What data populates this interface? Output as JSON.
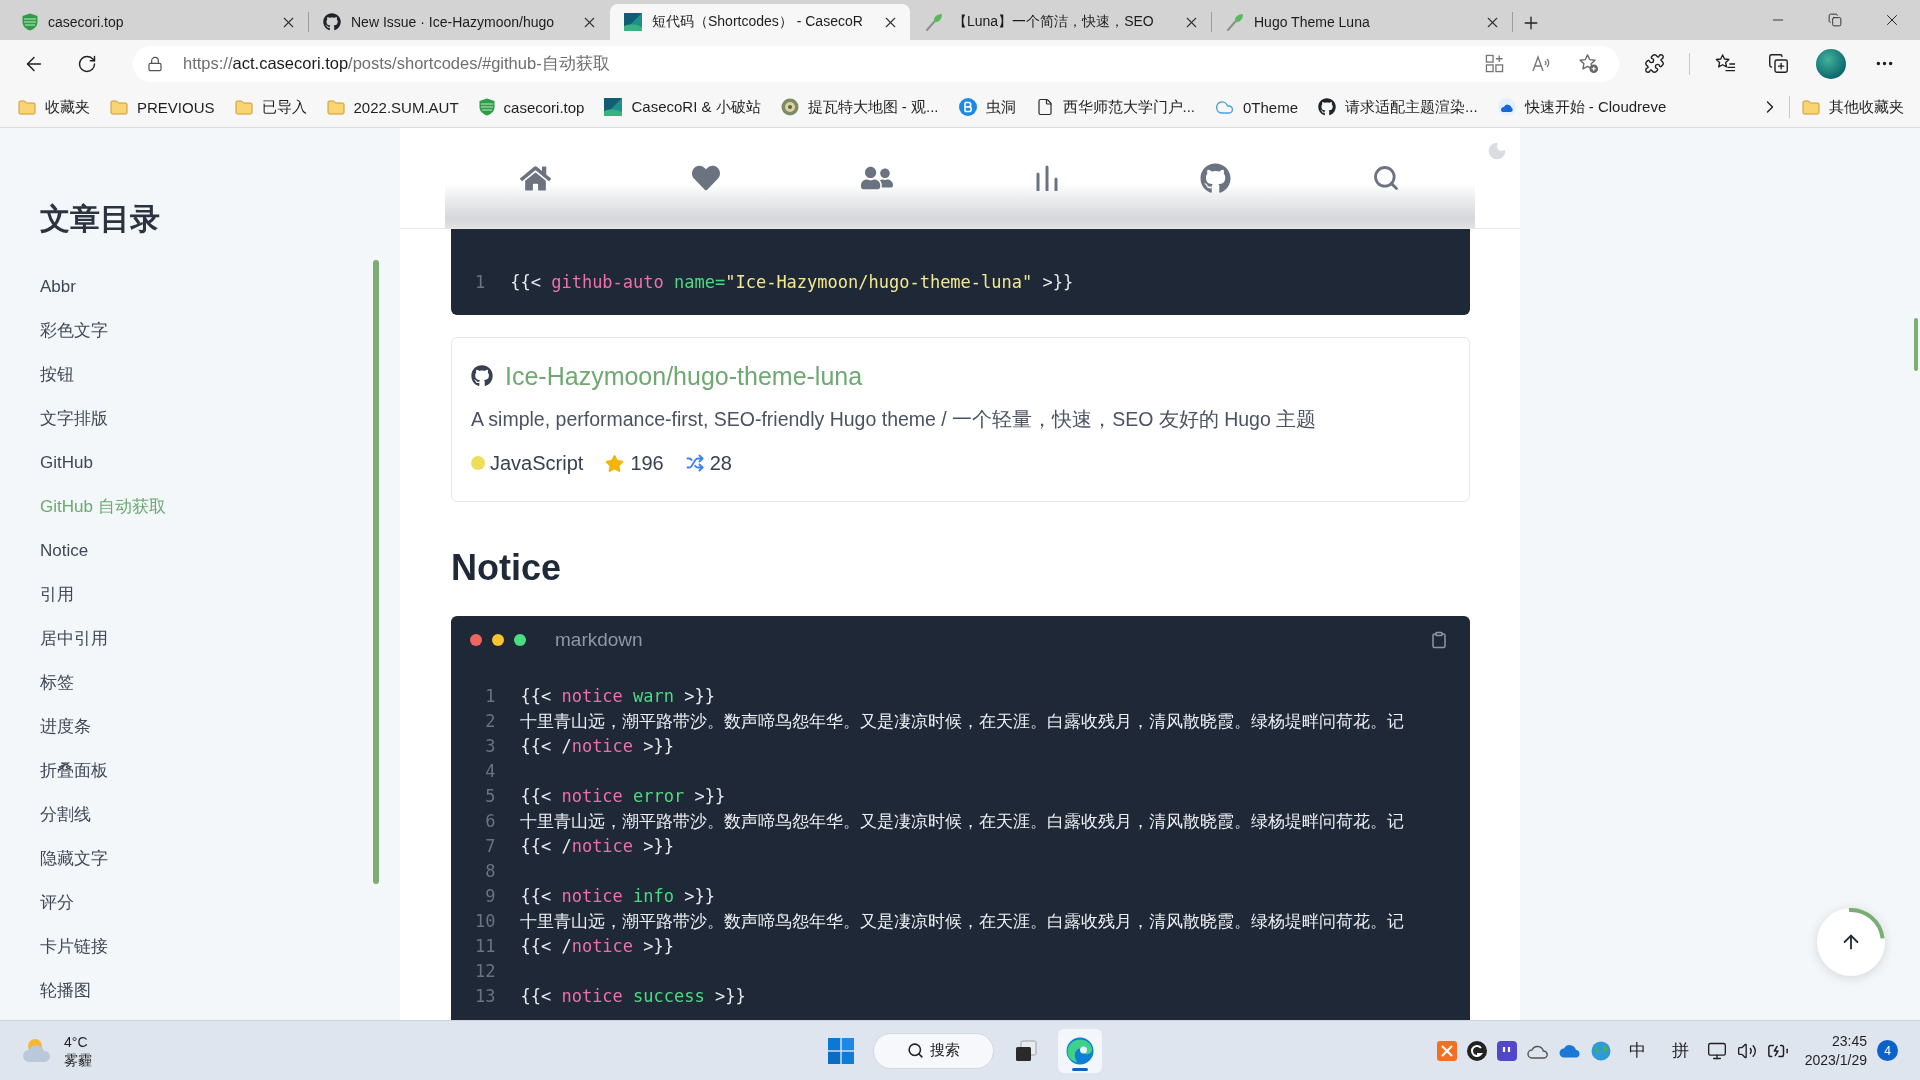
{
  "browser": {
    "tabs": [
      {
        "title": "casecori.top",
        "kind": "shield",
        "selected": false
      },
      {
        "title": "New Issue · Ice-Hazymoon/hugo",
        "kind": "github",
        "selected": false
      },
      {
        "title": "短代码（Shortcodes） - CasecoR",
        "kind": "tile",
        "selected": true
      },
      {
        "title": "【Luna】一个简洁，快速，SEO",
        "kind": "leaf",
        "selected": false
      },
      {
        "title": "Hugo Theme Luna",
        "kind": "leaf",
        "selected": false
      }
    ],
    "url": {
      "scheme": "https://",
      "host": "act.casecori.top",
      "path": "/posts/shortcodes/#github-自动获取"
    },
    "bookmarks": [
      {
        "label": "收藏夹",
        "kind": "folder"
      },
      {
        "label": "PREVIOUS",
        "kind": "folder"
      },
      {
        "label": "已导入",
        "kind": "folder"
      },
      {
        "label": "2022.SUM.AUT",
        "kind": "folder"
      },
      {
        "label": "casecori.top",
        "kind": "shield"
      },
      {
        "label": "CasecoRI & 小破站",
        "kind": "tile"
      },
      {
        "label": "提瓦特大地图 - 观...",
        "kind": "emblem"
      },
      {
        "label": "虫洞",
        "kind": "disc"
      },
      {
        "label": "西华师范大学门户...",
        "kind": "page"
      },
      {
        "label": "0Theme",
        "kind": "cloud"
      },
      {
        "label": "请求适配主题渲染...",
        "kind": "github"
      },
      {
        "label": "快速开始 - Cloudreve",
        "kind": "cloudlogo"
      }
    ],
    "other_bookmarks": {
      "label": "其他收藏夹",
      "kind": "folder"
    }
  },
  "toc": {
    "title": "文章目录",
    "items": [
      {
        "label": "Abbr",
        "selected": false
      },
      {
        "label": "彩色文字",
        "selected": false
      },
      {
        "label": "按钮",
        "selected": false
      },
      {
        "label": "文字排版",
        "selected": false
      },
      {
        "label": "GitHub",
        "selected": false
      },
      {
        "label": "GitHub 自动获取",
        "selected": true
      },
      {
        "label": "Notice",
        "selected": false
      },
      {
        "label": "引用",
        "selected": false
      },
      {
        "label": "居中引用",
        "selected": false
      },
      {
        "label": "标签",
        "selected": false
      },
      {
        "label": "进度条",
        "selected": false
      },
      {
        "label": "折叠面板",
        "selected": false
      },
      {
        "label": "分割线",
        "selected": false
      },
      {
        "label": "隐藏文字",
        "selected": false
      },
      {
        "label": "评分",
        "selected": false
      },
      {
        "label": "卡片链接",
        "selected": false
      },
      {
        "label": "轮播图",
        "selected": false
      }
    ]
  },
  "article": {
    "blocks": [
      {
        "kind": "code",
        "lines": [
          {
            "number": "1",
            "tokens": [
              {
                "text": "{{< ",
                "kind": "punct"
              },
              {
                "text": "github-auto",
                "kind": "name"
              },
              {
                "text": " name=",
                "kind": "param"
              },
              {
                "text": "\"Ice-Hazymoon/hugo-theme-luna\"",
                "kind": "string"
              },
              {
                "text": " >}}",
                "kind": "punct"
              }
            ]
          }
        ]
      },
      {
        "kind": "repo",
        "name": "Ice-Hazymoon/hugo-theme-luna",
        "description": "A simple, performance-first, SEO-friendly Hugo theme / 一个轻量，快速，SEO 友好的 Hugo 主题",
        "language": "JavaScript",
        "star_count": "196",
        "fork_count": "28"
      },
      {
        "kind": "heading",
        "text": "Notice"
      },
      {
        "kind": "code",
        "language": "markdown",
        "lines": [
          {
            "number": "1",
            "tokens": [
              {
                "text": "{{< ",
                "kind": "punct"
              },
              {
                "text": "notice",
                "kind": "name"
              },
              {
                "text": " warn",
                "kind": "param"
              },
              {
                "text": " >}}",
                "kind": "punct"
              }
            ]
          },
          {
            "number": "2",
            "tokens": [
              {
                "text": "十里青山远，潮平路带沙。数声啼鸟怨年华。又是凄凉时候，在天涯。白露收残月，清风散晓霞。绿杨堤畔问荷花。记",
                "kind": "text"
              }
            ]
          },
          {
            "number": "3",
            "tokens": [
              {
                "text": "{{< /",
                "kind": "punct"
              },
              {
                "text": "notice",
                "kind": "name"
              },
              {
                "text": " >}}",
                "kind": "punct"
              }
            ]
          },
          {
            "number": "4"
          },
          {
            "number": "5",
            "tokens": [
              {
                "text": "{{< ",
                "kind": "punct"
              },
              {
                "text": "notice",
                "kind": "name"
              },
              {
                "text": " error",
                "kind": "param"
              },
              {
                "text": " >}}",
                "kind": "punct"
              }
            ]
          },
          {
            "number": "6",
            "tokens": [
              {
                "text": "十里青山远，潮平路带沙。数声啼鸟怨年华。又是凄凉时候，在天涯。白露收残月，清风散晓霞。绿杨堤畔问荷花。记",
                "kind": "text"
              }
            ]
          },
          {
            "number": "7",
            "tokens": [
              {
                "text": "{{< /",
                "kind": "punct"
              },
              {
                "text": "notice",
                "kind": "name"
              },
              {
                "text": " >}}",
                "kind": "punct"
              }
            ]
          },
          {
            "number": "8"
          },
          {
            "number": "9",
            "tokens": [
              {
                "text": "{{< ",
                "kind": "punct"
              },
              {
                "text": "notice",
                "kind": "name"
              },
              {
                "text": " info",
                "kind": "param"
              },
              {
                "text": " >}}",
                "kind": "punct"
              }
            ]
          },
          {
            "number": "10",
            "tokens": [
              {
                "text": "十里青山远，潮平路带沙。数声啼鸟怨年华。又是凄凉时候，在天涯。白露收残月，清风散晓霞。绿杨堤畔问荷花。记",
                "kind": "text"
              }
            ]
          },
          {
            "number": "11",
            "tokens": [
              {
                "text": "{{< /",
                "kind": "punct"
              },
              {
                "text": "notice",
                "kind": "name"
              },
              {
                "text": " >}}",
                "kind": "punct"
              }
            ]
          },
          {
            "number": "12"
          },
          {
            "number": "13",
            "tokens": [
              {
                "text": "{{< ",
                "kind": "punct"
              },
              {
                "text": "notice",
                "kind": "name"
              },
              {
                "text": " success",
                "kind": "param"
              },
              {
                "text": " >}}",
                "kind": "punct"
              }
            ]
          }
        ]
      }
    ]
  },
  "taskbar": {
    "weather": {
      "temperature": "4°C",
      "condition": "雾霾"
    },
    "search": "搜索",
    "apps": [
      {
        "kind": "stack",
        "active": false
      },
      {
        "kind": "browser",
        "active": true
      }
    ],
    "input_indicators": [
      "中",
      "拼"
    ],
    "clock": {
      "time": "23:45",
      "date": "2023/1/29"
    },
    "notifications": "4"
  }
}
